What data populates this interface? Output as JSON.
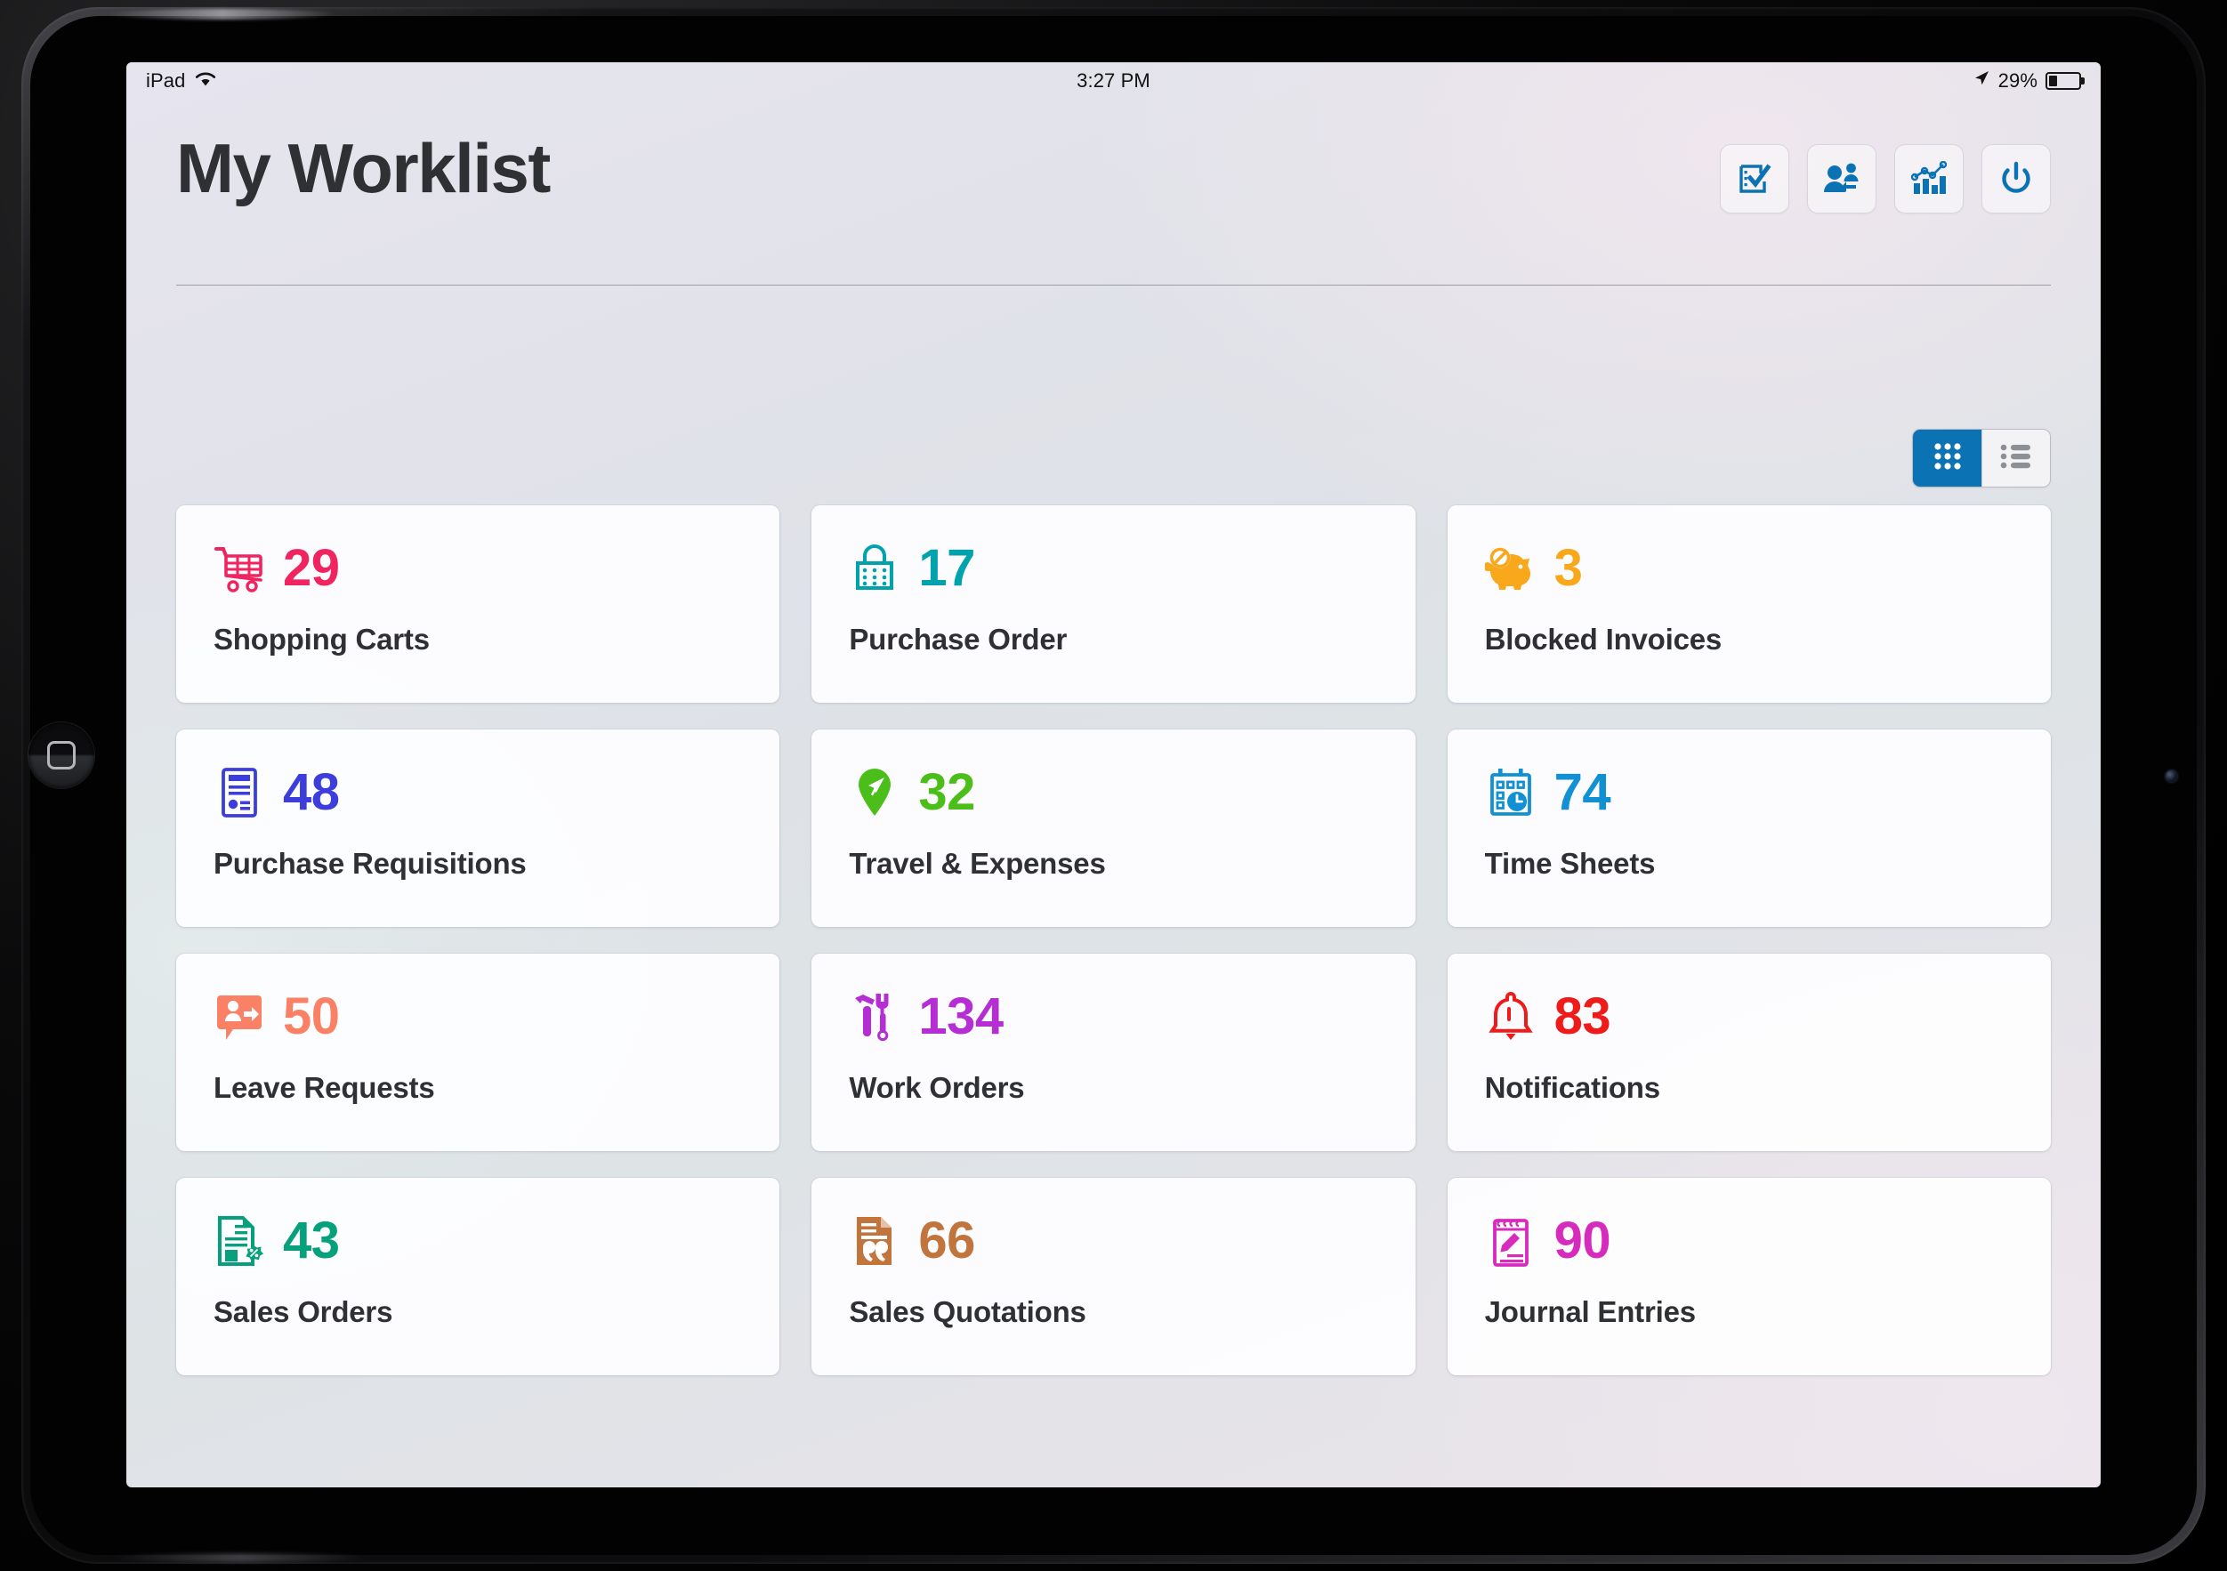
{
  "device": {
    "kind": "ipad",
    "orientation": "landscape"
  },
  "status_bar": {
    "carrier_label": "iPad",
    "wifi_icon": "wifi-icon",
    "time": "3:27 PM",
    "location_icon": "location-arrow-icon",
    "battery_percent": "29%",
    "battery_level": 29,
    "battery_icon": "battery-icon"
  },
  "header": {
    "title": "My Worklist",
    "actions": [
      {
        "name": "tasks-button",
        "icon": "checklist-icon",
        "color": "#0b73b4"
      },
      {
        "name": "substitute-button",
        "icon": "user-substitute-icon",
        "color": "#0b73b4"
      },
      {
        "name": "analytics-button",
        "icon": "bar-chart-line-icon",
        "color": "#0b73b4"
      },
      {
        "name": "logout-button",
        "icon": "power-icon",
        "color": "#0b73b4"
      }
    ]
  },
  "view_toggle": {
    "options": [
      {
        "name": "grid-view",
        "icon": "grid-icon",
        "active": true
      },
      {
        "name": "list-view",
        "icon": "list-icon",
        "active": false
      }
    ],
    "active_color": "#0b73b4",
    "inactive_color": "#f3f2f5",
    "inactive_icon_color": "#8d8f96"
  },
  "tiles": [
    {
      "count": "29",
      "label": "Shopping Carts",
      "icon": "shopping-cart-icon",
      "color": "#f0255f"
    },
    {
      "count": "17",
      "label": "Purchase Order",
      "icon": "shopping-bag-icon",
      "color": "#00a3ac"
    },
    {
      "count": "3",
      "label": "Blocked Invoices",
      "icon": "blocked-piggy-icon",
      "color": "#f9a71b"
    },
    {
      "count": "48",
      "label": "Purchase Requisitions",
      "icon": "form-document-icon",
      "color": "#3d3ddb"
    },
    {
      "count": "32",
      "label": "Travel & Expenses",
      "icon": "flight-pin-icon",
      "color": "#4cbe1a"
    },
    {
      "count": "74",
      "label": "Time Sheets",
      "icon": "calendar-clock-icon",
      "color": "#1190d3"
    },
    {
      "count": "50",
      "label": "Leave Requests",
      "icon": "leave-request-icon",
      "color": "#fa8166"
    },
    {
      "count": "134",
      "label": "Work Orders",
      "icon": "tools-icon",
      "color": "#b42ed4"
    },
    {
      "count": "83",
      "label": "Notifications",
      "icon": "bell-icon",
      "color": "#ee1b1b"
    },
    {
      "count": "43",
      "label": "Sales Orders",
      "icon": "sales-order-icon",
      "color": "#07a07c"
    },
    {
      "count": "66",
      "label": "Sales Quotations",
      "icon": "quotation-doc-icon",
      "color": "#c1743c"
    },
    {
      "count": "90",
      "label": "Journal Entries",
      "icon": "notepad-pencil-icon",
      "color": "#d72bbe"
    }
  ]
}
